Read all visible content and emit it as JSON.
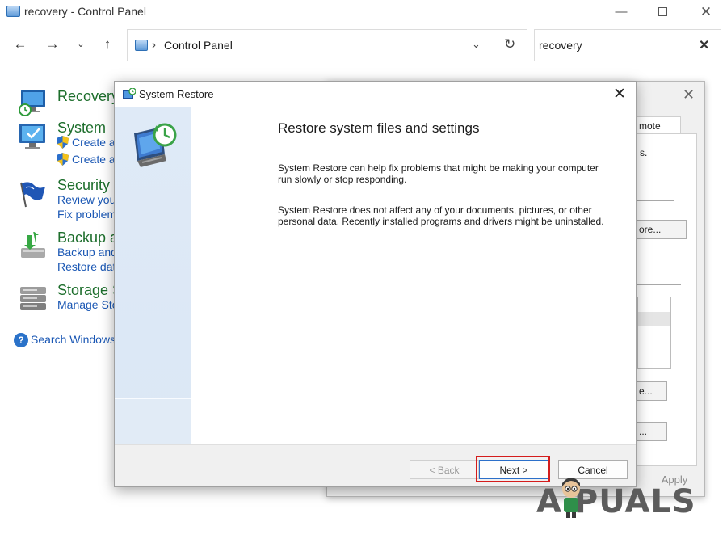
{
  "control_panel": {
    "window_title": "recovery - Control Panel",
    "window_controls": {
      "minimize": "—",
      "close": "✕"
    },
    "nav": {
      "back": "←",
      "forward": "→",
      "recent": "⌄",
      "up": "↑"
    },
    "address": {
      "separator": "›",
      "path": "Control Panel",
      "dropdown": "⌄",
      "refresh": "↻"
    },
    "search": {
      "value": "recovery",
      "clear": "✕"
    },
    "sections": [
      {
        "heading": "Recovery",
        "icon": "recovery-icon",
        "links": []
      },
      {
        "heading": "System",
        "icon": "system-monitor-icon",
        "links": [
          "Create a",
          "Create a"
        ]
      },
      {
        "heading": "Security",
        "icon": "security-flag-icon",
        "links": [
          "Review you",
          "Fix problem"
        ]
      },
      {
        "heading": "Backup a",
        "icon": "backup-icon",
        "links": [
          "Backup and",
          "Restore dat"
        ]
      },
      {
        "heading": "Storage S",
        "icon": "storage-icon",
        "links": [
          "Manage Sto"
        ]
      }
    ],
    "help": {
      "icon_text": "?",
      "label": "Search Windows"
    }
  },
  "system_properties": {
    "close": "✕",
    "tab_label": "mote",
    "partial_text": "s.",
    "button_1": "ore...",
    "button_2": "e...",
    "button_3": "...",
    "apply_label": "Apply"
  },
  "restore_dialog": {
    "title": "System Restore",
    "close": "✕",
    "heading": "Restore system files and settings",
    "paragraph_1": "System Restore can help fix problems that might be making your computer run slowly or stop responding.",
    "paragraph_2": "System Restore does not affect any of your documents, pictures, or other personal data. Recently installed programs and drivers might be uninstalled.",
    "back_label": "< Back",
    "next_label": "Next >",
    "cancel_label": "Cancel",
    "highlight_color": "#d41c1c"
  },
  "watermark": {
    "text": "A  PUALS"
  }
}
